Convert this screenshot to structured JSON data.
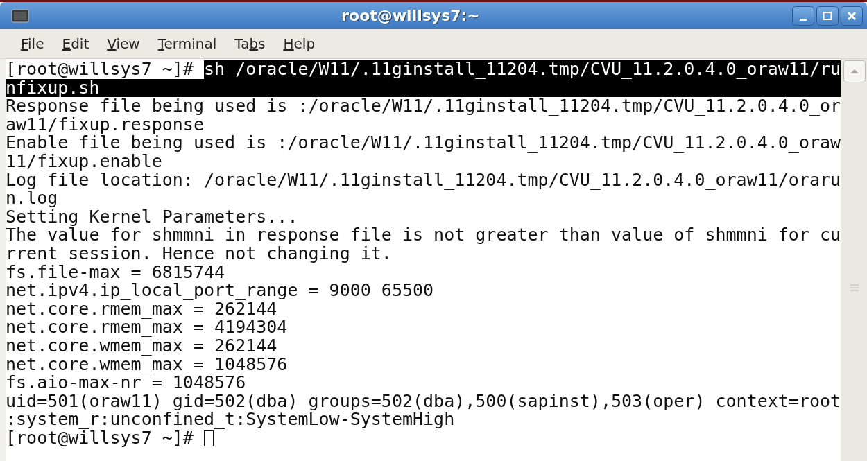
{
  "window": {
    "title": "root@willsys7:~"
  },
  "menu": [
    {
      "label": "File"
    },
    {
      "label": "Edit"
    },
    {
      "label": "View"
    },
    {
      "label": "Terminal"
    },
    {
      "label": "Tabs"
    },
    {
      "label": "Help"
    }
  ],
  "terminal": {
    "lines": [
      {
        "prompt": "[root@willsys7 ~]#",
        "text": "sh /oracle/W11/.11ginstall_11204.tmp/CVU_11.2.0.4.0_oraw11/ru",
        "selected": true
      },
      {
        "text": "nfixup.sh",
        "selected": true
      },
      {
        "text": "Response file being used is :/oracle/W11/.11ginstall_11204.tmp/CVU_11.2.0.4.0_or",
        "selected": false
      },
      {
        "text": "aw11/fixup.response",
        "selected": false
      },
      {
        "text": "Enable file being used is :/oracle/W11/.11ginstall_11204.tmp/CVU_11.2.0.4.0_oraw",
        "selected": false
      },
      {
        "text": "11/fixup.enable",
        "selected": false
      },
      {
        "text": "Log file location: /oracle/W11/.11ginstall_11204.tmp/CVU_11.2.0.4.0_oraw11/oraru",
        "selected": false
      },
      {
        "text": "n.log",
        "selected": false
      },
      {
        "text": "Setting Kernel Parameters...",
        "selected": false
      },
      {
        "text": "The value for shmmni in response file is not greater than value of shmmni for cu",
        "selected": false
      },
      {
        "text": "rrent session. Hence not changing it.",
        "selected": false
      },
      {
        "text": "fs.file-max = 6815744",
        "selected": false
      },
      {
        "text": "net.ipv4.ip_local_port_range = 9000 65500",
        "selected": false
      },
      {
        "text": "net.core.rmem_max = 262144",
        "selected": false
      },
      {
        "text": "net.core.rmem_max = 4194304",
        "selected": false
      },
      {
        "text": "net.core.wmem_max = 262144",
        "selected": false
      },
      {
        "text": "net.core.wmem_max = 1048576",
        "selected": false
      },
      {
        "text": "fs.aio-max-nr = 1048576",
        "selected": false
      },
      {
        "text": "uid=501(oraw11) gid=502(dba) groups=502(dba),500(sapinst),503(oper) context=root",
        "selected": false
      },
      {
        "text": ":system_r:unconfined_t:SystemLow-SystemHigh",
        "selected": false
      },
      {
        "prompt": "[root@willsys7 ~]#",
        "selected": false,
        "cursor": true
      }
    ]
  }
}
